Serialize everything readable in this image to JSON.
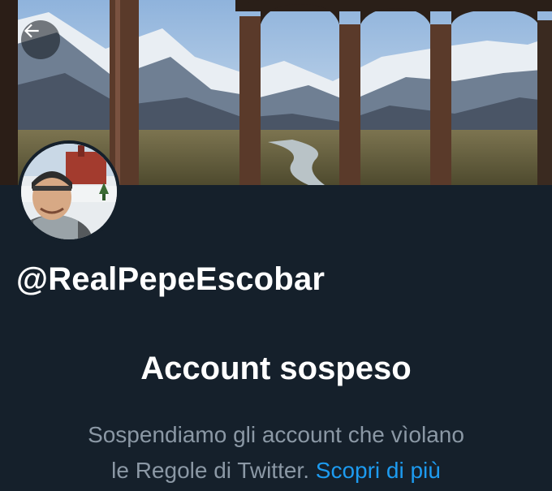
{
  "header": {
    "back_icon": "arrow-left-icon"
  },
  "profile": {
    "handle": "@RealPepeEscobar"
  },
  "suspension": {
    "title": "Account sospeso",
    "description_line1": "Sospendiamo gli account che vìolano",
    "description_line2": "le Regole di Twitter.",
    "learn_more": "Scopri di più"
  },
  "colors": {
    "background": "#15202b",
    "link": "#1d9bf0",
    "secondary_text": "#8b98a5"
  }
}
